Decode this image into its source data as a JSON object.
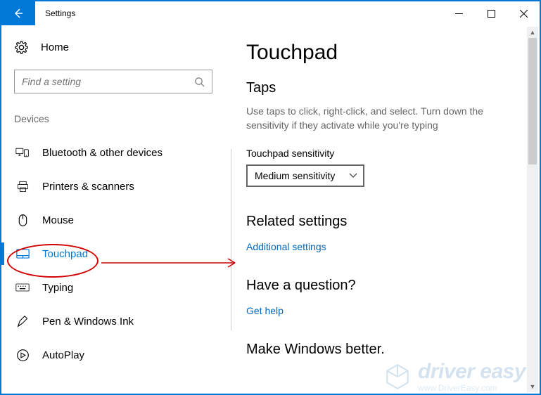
{
  "titlebar": {
    "title": "Settings"
  },
  "sidebar": {
    "home_label": "Home",
    "search_placeholder": "Find a setting",
    "group_label": "Devices",
    "items": [
      {
        "label": "Bluetooth & other devices",
        "icon": "bluetooth-devices-icon"
      },
      {
        "label": "Printers & scanners",
        "icon": "printer-icon"
      },
      {
        "label": "Mouse",
        "icon": "mouse-icon"
      },
      {
        "label": "Touchpad",
        "icon": "touchpad-icon"
      },
      {
        "label": "Typing",
        "icon": "keyboard-icon"
      },
      {
        "label": "Pen & Windows Ink",
        "icon": "pen-icon"
      },
      {
        "label": "AutoPlay",
        "icon": "autoplay-icon"
      }
    ]
  },
  "main": {
    "heading": "Touchpad",
    "taps_heading": "Taps",
    "taps_desc": "Use taps to click, right-click, and select. Turn down the sensitivity if they activate while you're typing",
    "sensitivity_label": "Touchpad sensitivity",
    "sensitivity_value": "Medium sensitivity",
    "related_heading": "Related settings",
    "related_link": "Additional settings",
    "question_heading": "Have a question?",
    "question_link": "Get help",
    "better_heading": "Make Windows better."
  },
  "watermark": {
    "brand": "driver easy",
    "url": "www.DriverEasy.com"
  }
}
